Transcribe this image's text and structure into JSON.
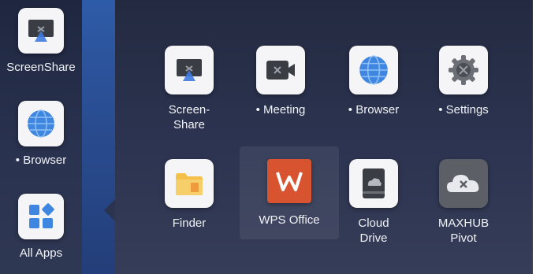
{
  "sidebar": {
    "items": [
      {
        "label": "ScreenShare",
        "icon": "screenshare-icon"
      },
      {
        "label": "• Browser",
        "icon": "globe-icon"
      },
      {
        "label": "All Apps",
        "icon": "apps-grid-icon"
      }
    ]
  },
  "apps": [
    {
      "label": "Screen-\nShare",
      "icon": "screenshare-icon"
    },
    {
      "label": "• Meeting",
      "icon": "video-camera-icon"
    },
    {
      "label": "• Browser",
      "icon": "globe-icon"
    },
    {
      "label": "• Settings",
      "icon": "gear-icon"
    },
    {
      "label": "Finder",
      "icon": "folder-icon"
    },
    {
      "label": "WPS Office",
      "icon": "wps-logo-icon"
    },
    {
      "label": "Cloud\nDrive",
      "icon": "cloud-drive-icon"
    },
    {
      "label": "MAXHUB\nPivot",
      "icon": "cloud-x-icon"
    }
  ],
  "colors": {
    "accent_blue": "#2e5ba8",
    "wps_red": "#d8532f",
    "folder_yellow": "#f5c04a"
  }
}
